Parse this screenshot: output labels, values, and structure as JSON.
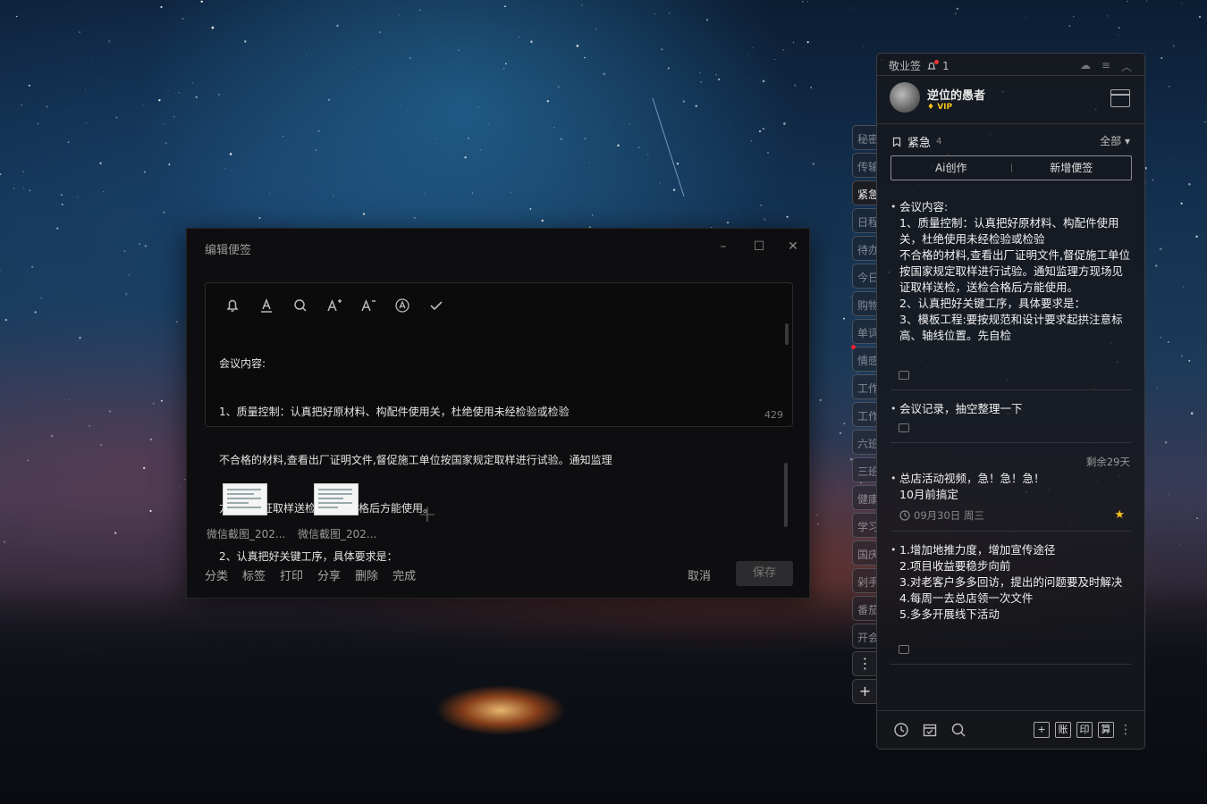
{
  "editor": {
    "title": "编辑便签",
    "content_lines": [
      "会议内容:",
      "1、质量控制：认真把好原材料、构配件使用关，杜绝使用未经检验或检验",
      "不合格的材料,查看出厂证明文件,督促施工单位按国家规定取样进行试验。通知监理",
      "方现场见证取样送检，送检合格后方能使用。",
      "2、认真把好关键工序，具体要求是："
    ],
    "char_count": "429",
    "attachments": [
      {
        "name": "微信截图_202..."
      },
      {
        "name": "微信截图_202..."
      }
    ],
    "bottom_actions": [
      "分类",
      "标签",
      "打印",
      "分享",
      "删除",
      "完成"
    ],
    "cancel_label": "取消",
    "save_label": "保存"
  },
  "sidebar_tabs": [
    "秘密",
    "传输",
    "紧急",
    "日程",
    "待办",
    "今日",
    "购物",
    "单词",
    "情感",
    "工作",
    "工作",
    "六班",
    "三班",
    "健康",
    "学习",
    "国庆",
    "剁手",
    "番茄",
    "开会"
  ],
  "active_tab_index": 2,
  "panel": {
    "app_name": "敬业签",
    "notification_count": "1",
    "username": "逆位的愚者",
    "vip_label": "VIP",
    "category": "紧急",
    "category_count": "4",
    "filter_label": "全部",
    "ai_label": "Ai创作",
    "new_note_label": "新增便签",
    "notes": [
      {
        "text": "会议内容:\n1、质量控制：认真把好原材料、构配件使用关，杜绝使用未经检验或检验\n不合格的材料,查看出厂证明文件,督促施工单位按国家规定取样进行试验。通知监理方现场见证取样送检，送检合格后方能使用。\n2、认真把好关键工序，具体要求是：\n3、模板工程:要按规范和设计要求起拱注意标高、轴线位置。先自检"
      },
      {
        "text": "会议记录，抽空整理一下"
      },
      {
        "remaining": "剩余29天",
        "text": "总店活动视频，急！急！急！\n10月前搞定",
        "date": "09月30日 周三"
      },
      {
        "text": "1.增加地推力度，增加宣传途径\n2.项目收益要稳步向前\n3.对老客户多多回访，提出的问题要及时解决\n4.每周一去总店领一次文件\n5.多多开展线下活动"
      }
    ],
    "footer_buttons": [
      "账",
      "印",
      "算"
    ]
  }
}
